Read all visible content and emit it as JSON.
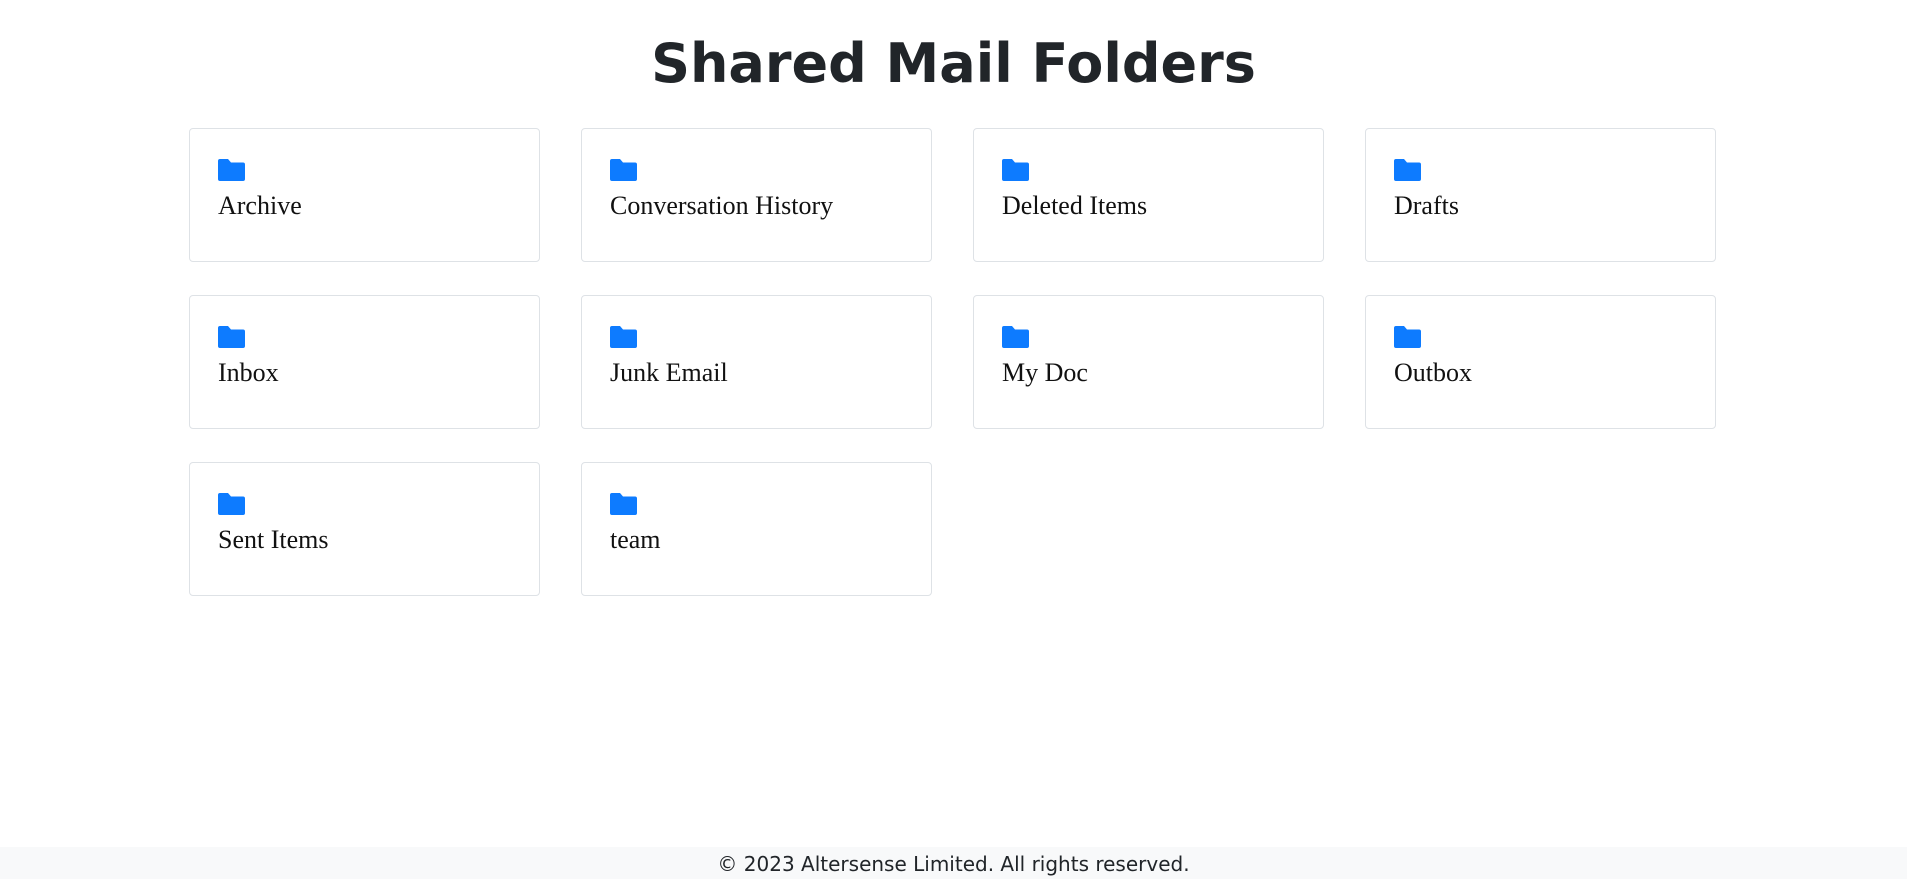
{
  "page": {
    "title": "Shared Mail Folders"
  },
  "folders": [
    {
      "name": "Archive",
      "icon": "folder-icon"
    },
    {
      "name": "Conversation History",
      "icon": "folder-icon"
    },
    {
      "name": "Deleted Items",
      "icon": "folder-icon"
    },
    {
      "name": "Drafts",
      "icon": "folder-icon"
    },
    {
      "name": "Inbox",
      "icon": "folder-icon"
    },
    {
      "name": "Junk Email",
      "icon": "folder-icon"
    },
    {
      "name": "My Doc",
      "icon": "folder-icon"
    },
    {
      "name": "Outbox",
      "icon": "folder-icon"
    },
    {
      "name": "Sent Items",
      "icon": "folder-icon"
    },
    {
      "name": "team",
      "icon": "folder-icon"
    }
  ],
  "footer": {
    "text": "© 2023 Altersense Limited. All rights reserved."
  },
  "colors": {
    "accent": "#0d7bff",
    "card_border": "#dee2e6",
    "footer_bg": "#f8f9fa",
    "text": "#212529"
  }
}
